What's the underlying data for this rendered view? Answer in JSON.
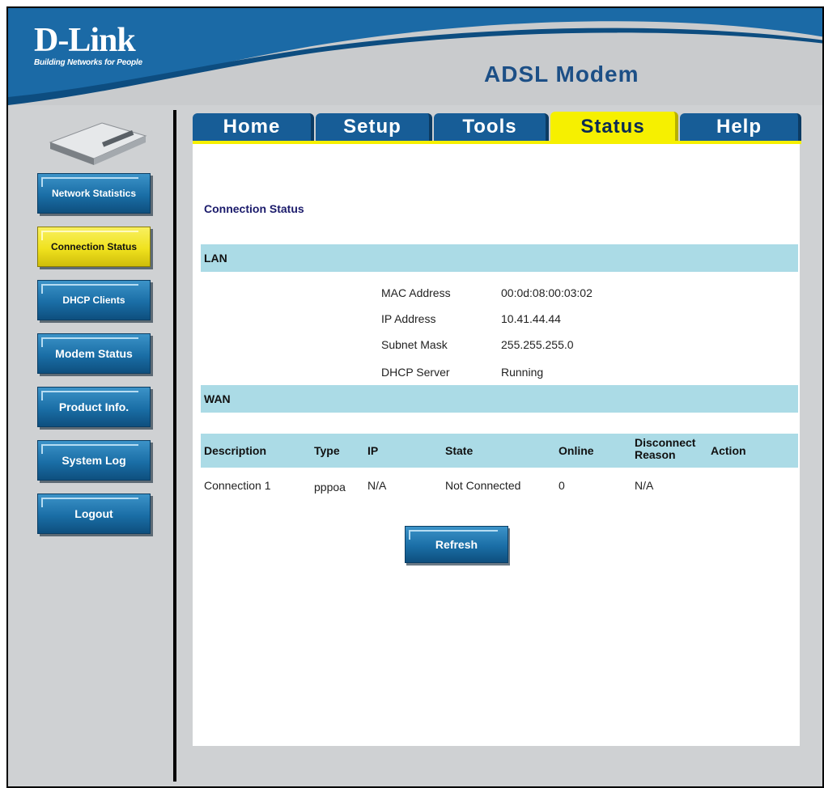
{
  "header": {
    "brand": "D-Link",
    "tagline": "Building Networks for People",
    "product": "ADSL Modem"
  },
  "tabs": [
    {
      "label": "Home"
    },
    {
      "label": "Setup"
    },
    {
      "label": "Tools"
    },
    {
      "label": "Status",
      "active": true
    },
    {
      "label": "Help"
    }
  ],
  "sidebar": {
    "items": [
      {
        "label": "Network Statistics"
      },
      {
        "label": "Connection Status",
        "active": true
      },
      {
        "label": "DHCP Clients"
      },
      {
        "label": "Modem Status"
      },
      {
        "label": "Product Info."
      },
      {
        "label": "System Log"
      },
      {
        "label": "Logout"
      }
    ]
  },
  "main": {
    "title": "Connection Status",
    "lan": {
      "heading": "LAN",
      "rows": [
        {
          "key": "MAC Address",
          "value": "00:0d:08:00:03:02"
        },
        {
          "key": "IP Address",
          "value": "10.41.44.44"
        },
        {
          "key": "Subnet Mask",
          "value": "255.255.255.0"
        },
        {
          "key": "DHCP Server",
          "value": "Running"
        }
      ]
    },
    "wan": {
      "heading": "WAN",
      "columns": {
        "description": "Description",
        "type": "Type",
        "ip": "IP",
        "state": "State",
        "online": "Online",
        "disconnect": "Disconnect",
        "reason": "Reason",
        "action": "Action"
      },
      "rows": [
        {
          "description": "Connection 1",
          "type": "pppoa",
          "ip": "N/A",
          "state": "Not Connected",
          "online": "0",
          "reason": "N/A",
          "action": ""
        }
      ]
    },
    "refresh_label": "Refresh"
  },
  "colors": {
    "brand_blue": "#1c6aa4",
    "tab_active": "#f6f000",
    "section_bar": "#abdbe6"
  }
}
